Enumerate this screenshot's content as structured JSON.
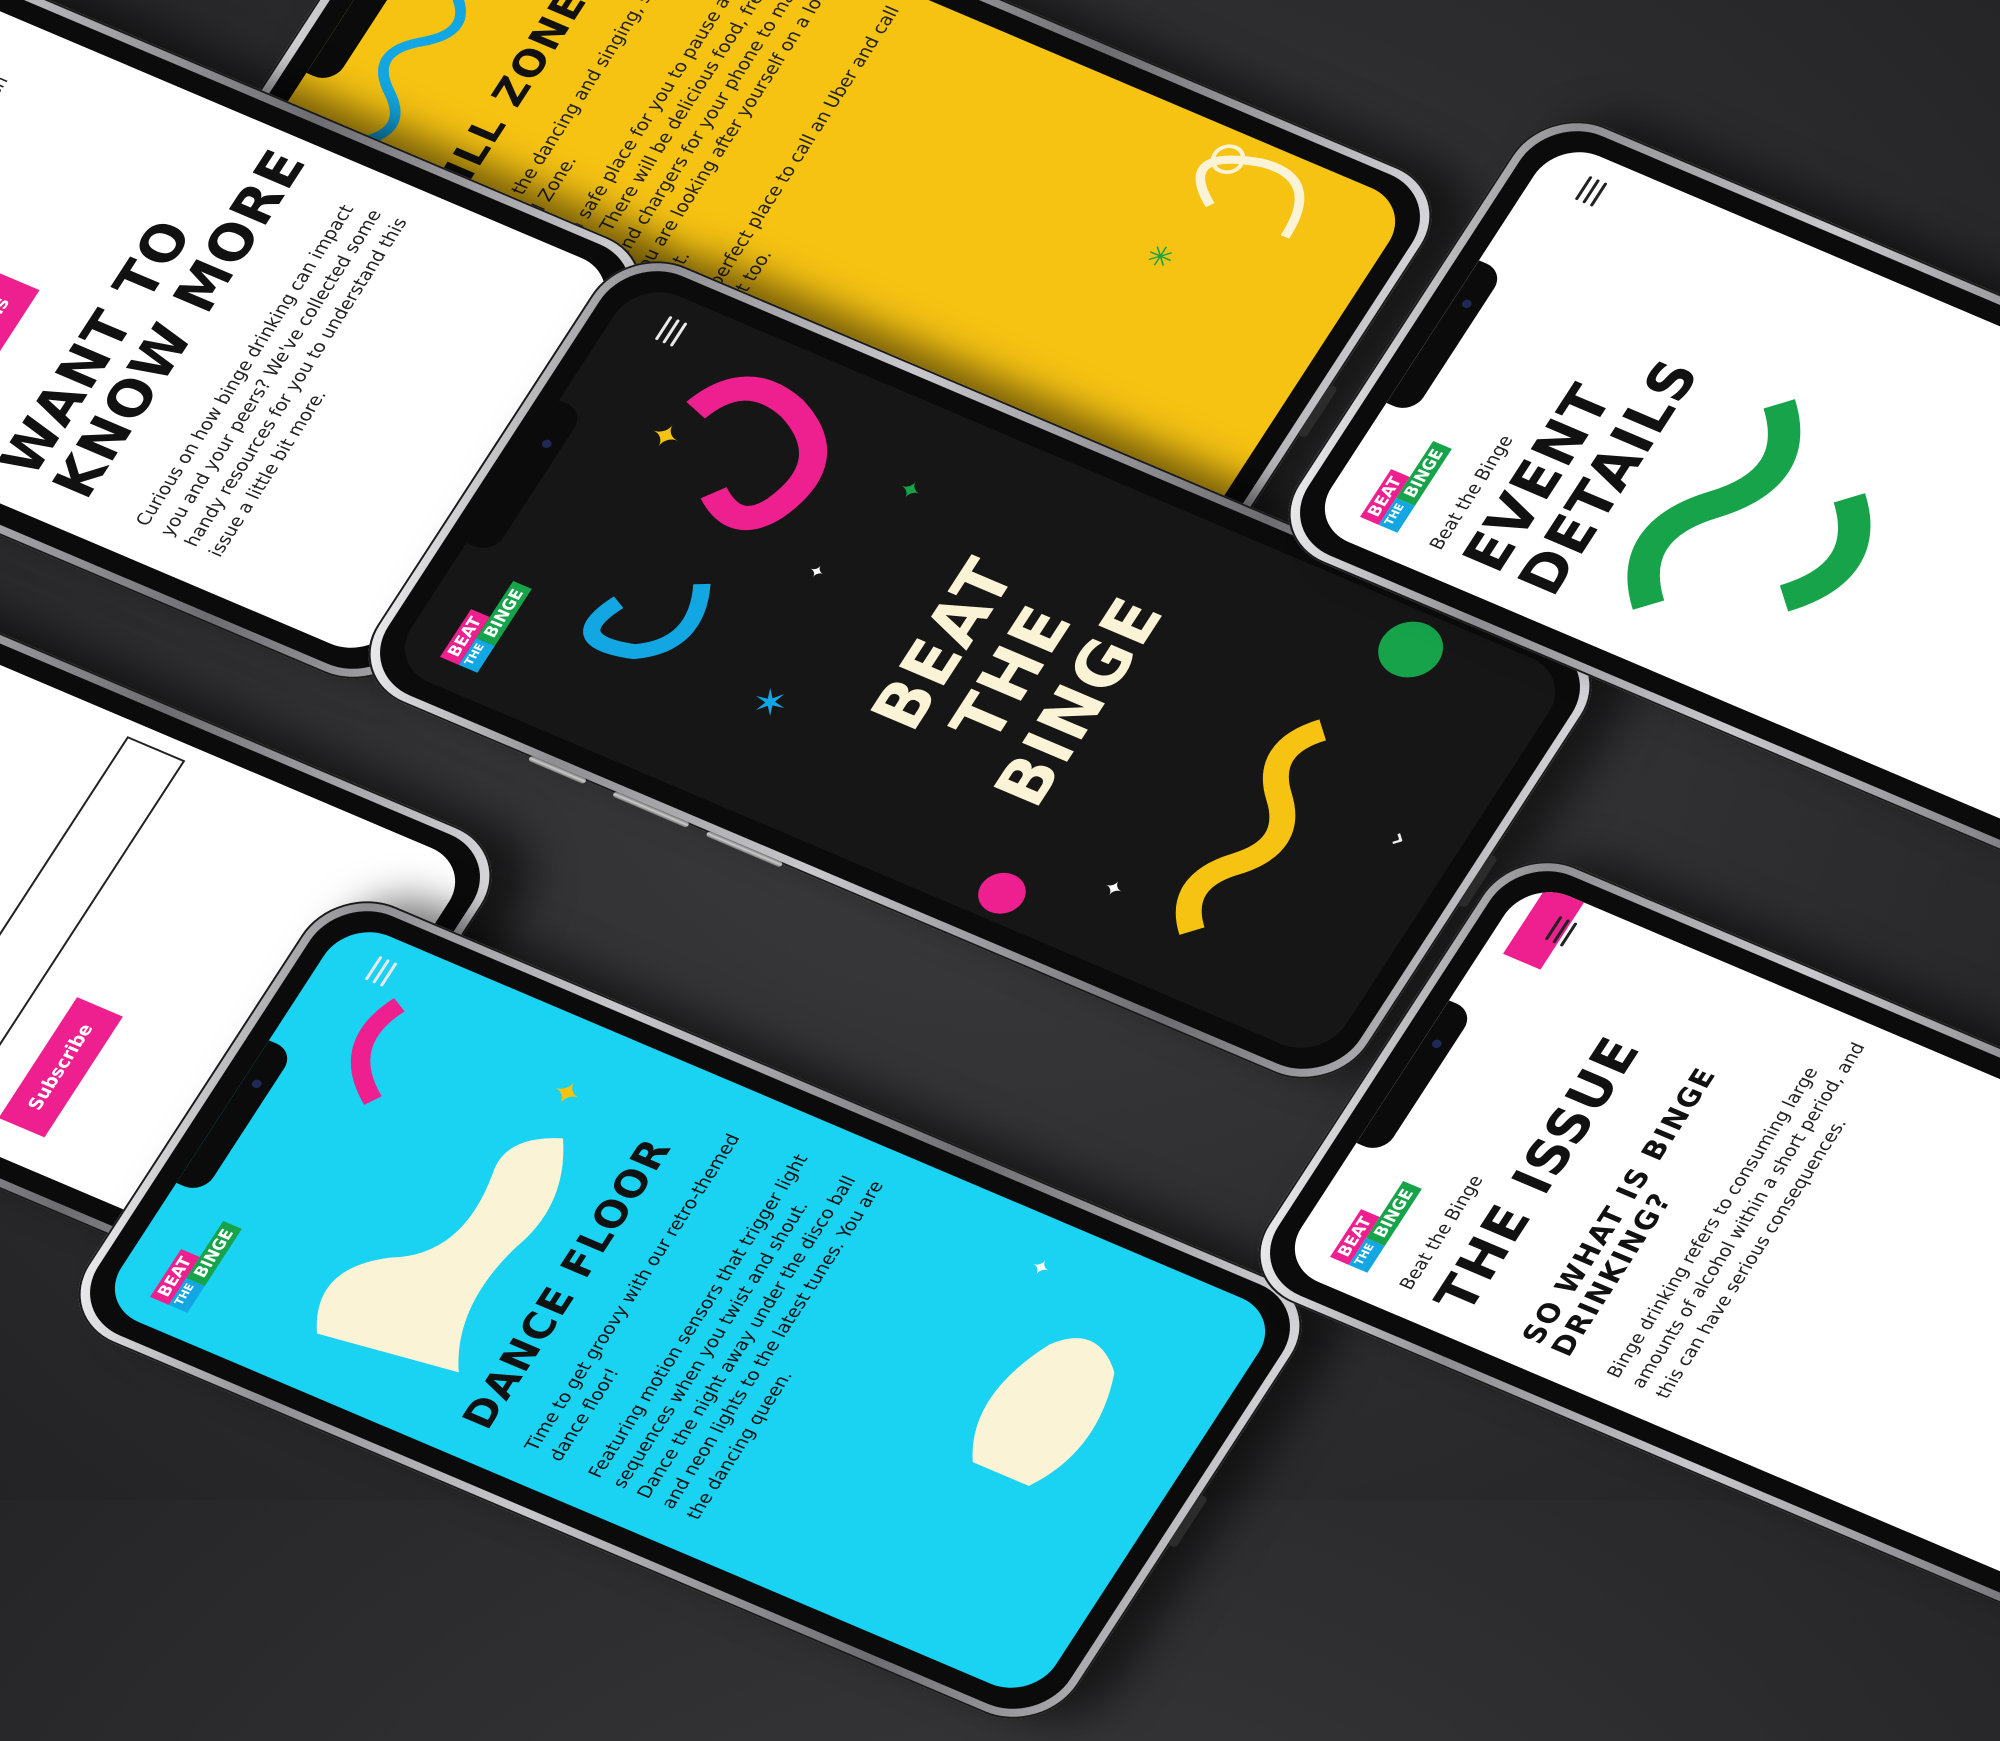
{
  "colors": {
    "background": "#2e2e30",
    "brand_pink": "#ee1f8e",
    "brand_blue": "#12a7e3",
    "brand_green": "#16a34a",
    "yellow": "#f6c313",
    "cyan": "#1ad2f2",
    "cream": "#fbf3d5",
    "dark_screen": "#161616"
  },
  "logo": {
    "line1": "BEAT",
    "line2": "THE",
    "line3": "BINGE"
  },
  "icons": [
    "menu-icon",
    "star-icon",
    "chevron-down-icon",
    "squiggle-shape"
  ],
  "home": {
    "title_line1": "BEAT",
    "title_line2": "THE",
    "title_line3": "BINGE",
    "scroll_hint": "⌄"
  },
  "chill_zone": {
    "title": "CHILL ZONE",
    "paragraphs": [
      "After all the dancing and singing, stop off at the Chill Zone.",
      "This is a safe place for you to pause and unwind. There will be delicious food, free water and chargers for your phone to make sure you are looking after yourself on a long night out.",
      "It's the perfect place to call an Uber and call it a night too."
    ]
  },
  "know_more": {
    "top_text": "bingeing ... and most importantly, reach out.",
    "button": "Event Details",
    "heading_line1": "WANT TO",
    "heading_line2": "KNOW MORE",
    "body": "Curious on how binge drinking can impact you and your peers? We've collected some handy resources for you to understand this issue a little bit more."
  },
  "subscribe": {
    "input_placeholder": "",
    "button": "Subscribe"
  },
  "event_details": {
    "breadcrumb": "Beat the Binge",
    "heading_line1": "EVENT",
    "heading_line2": "DETAILS"
  },
  "dance_floor": {
    "title": "DANCE FLOOR",
    "paragraphs": [
      "Time to get groovy with our retro-themed dance floor!",
      "Featuring motion sensors that trigger light sequences when you twist and shout. Dance the night away under the disco ball and neon lights to the latest tunes. You are the dancing queen."
    ]
  },
  "the_issue": {
    "breadcrumb": "Beat the Binge",
    "heading": "THE ISSUE",
    "subheading_line1": "SO WHAT IS BINGE",
    "subheading_line2": "DRINKING?",
    "body": "Binge drinking refers to consuming large amounts of alcohol within a short period, and this can have serious consequences."
  }
}
